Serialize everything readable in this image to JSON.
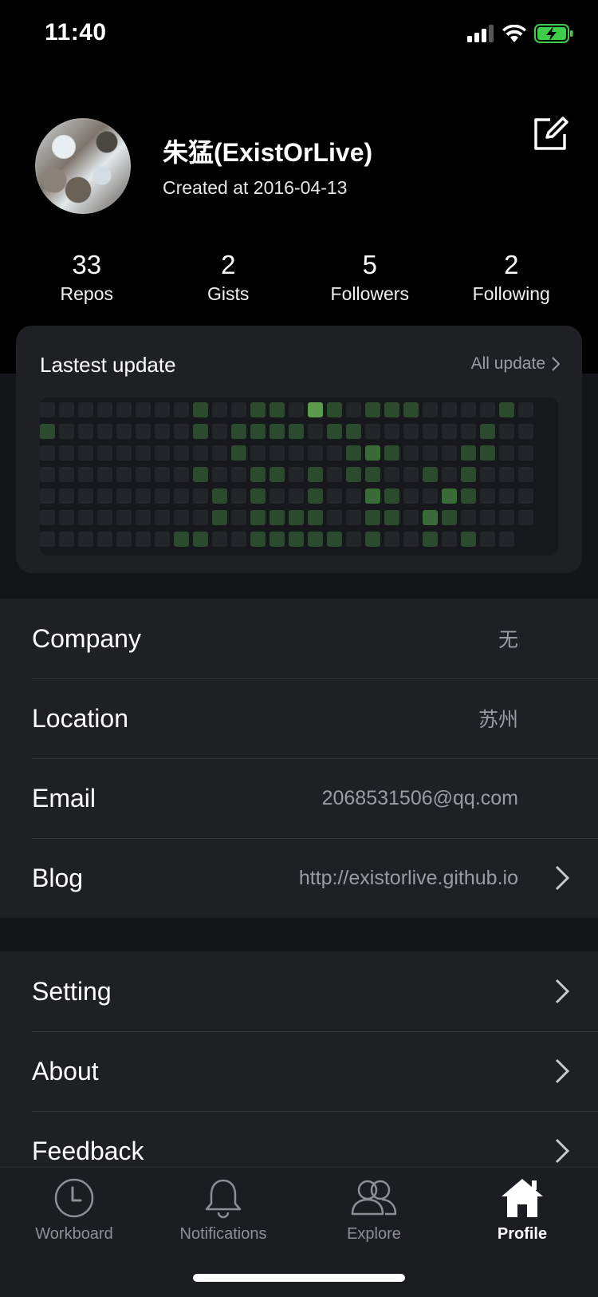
{
  "status_bar": {
    "time": "11:40",
    "icons": [
      "signal-icon",
      "wifi-icon",
      "battery-charging-icon"
    ],
    "battery_color": "#3ecf4a"
  },
  "profile": {
    "name": "朱猛(ExistOrLive)",
    "created": "Created at 2016-04-13",
    "stats": [
      {
        "value": "33",
        "label": "Repos"
      },
      {
        "value": "2",
        "label": "Gists"
      },
      {
        "value": "5",
        "label": "Followers"
      },
      {
        "value": "2",
        "label": "Following"
      }
    ]
  },
  "activity": {
    "title": "Lastest update",
    "link": "All update",
    "colors": {
      "level0": "#23252a",
      "level1": "#2c4a2e",
      "level2": "#3a6a38",
      "level3": "#5c9a4e"
    },
    "rows": [
      [
        0,
        0,
        0,
        0,
        0,
        0,
        0,
        0,
        1,
        0,
        0,
        1,
        1,
        0,
        3,
        1,
        0,
        1,
        1,
        1,
        0,
        0,
        0,
        0,
        1,
        0
      ],
      [
        1,
        0,
        0,
        0,
        0,
        0,
        0,
        0,
        1,
        0,
        1,
        1,
        1,
        1,
        0,
        1,
        1,
        0,
        0,
        0,
        0,
        0,
        0,
        1,
        0,
        0
      ],
      [
        0,
        0,
        0,
        0,
        0,
        0,
        0,
        0,
        0,
        0,
        1,
        0,
        0,
        0,
        0,
        0,
        1,
        2,
        1,
        0,
        0,
        0,
        1,
        1,
        0,
        0
      ],
      [
        0,
        0,
        0,
        0,
        0,
        0,
        0,
        0,
        1,
        0,
        0,
        1,
        1,
        0,
        1,
        0,
        1,
        1,
        0,
        0,
        1,
        0,
        1,
        0,
        0,
        0
      ],
      [
        0,
        0,
        0,
        0,
        0,
        0,
        0,
        0,
        0,
        1,
        0,
        1,
        0,
        0,
        1,
        0,
        0,
        2,
        1,
        0,
        0,
        2,
        1,
        0,
        0,
        0
      ],
      [
        0,
        0,
        0,
        0,
        0,
        0,
        0,
        0,
        0,
        1,
        0,
        1,
        1,
        1,
        1,
        0,
        0,
        1,
        1,
        0,
        2,
        1,
        0,
        0,
        0,
        0
      ],
      [
        0,
        0,
        0,
        0,
        0,
        0,
        0,
        1,
        1,
        0,
        0,
        1,
        1,
        1,
        1,
        1,
        0,
        1,
        0,
        0,
        1,
        0,
        1,
        0,
        0,
        -1
      ]
    ]
  },
  "info": {
    "company": {
      "label": "Company",
      "value": "无"
    },
    "location": {
      "label": "Location",
      "value": "苏州"
    },
    "email": {
      "label": "Email",
      "value": "2068531506@qq.com"
    },
    "blog": {
      "label": "Blog",
      "value": "http://existorlive.github.io"
    }
  },
  "menu": {
    "setting": "Setting",
    "about": "About",
    "feedback": "Feedback"
  },
  "tabs": [
    {
      "label": "Workboard",
      "icon": "clock-icon"
    },
    {
      "label": "Notifications",
      "icon": "bell-icon"
    },
    {
      "label": "Explore",
      "icon": "people-icon"
    },
    {
      "label": "Profile",
      "icon": "home-icon",
      "active": true
    }
  ]
}
